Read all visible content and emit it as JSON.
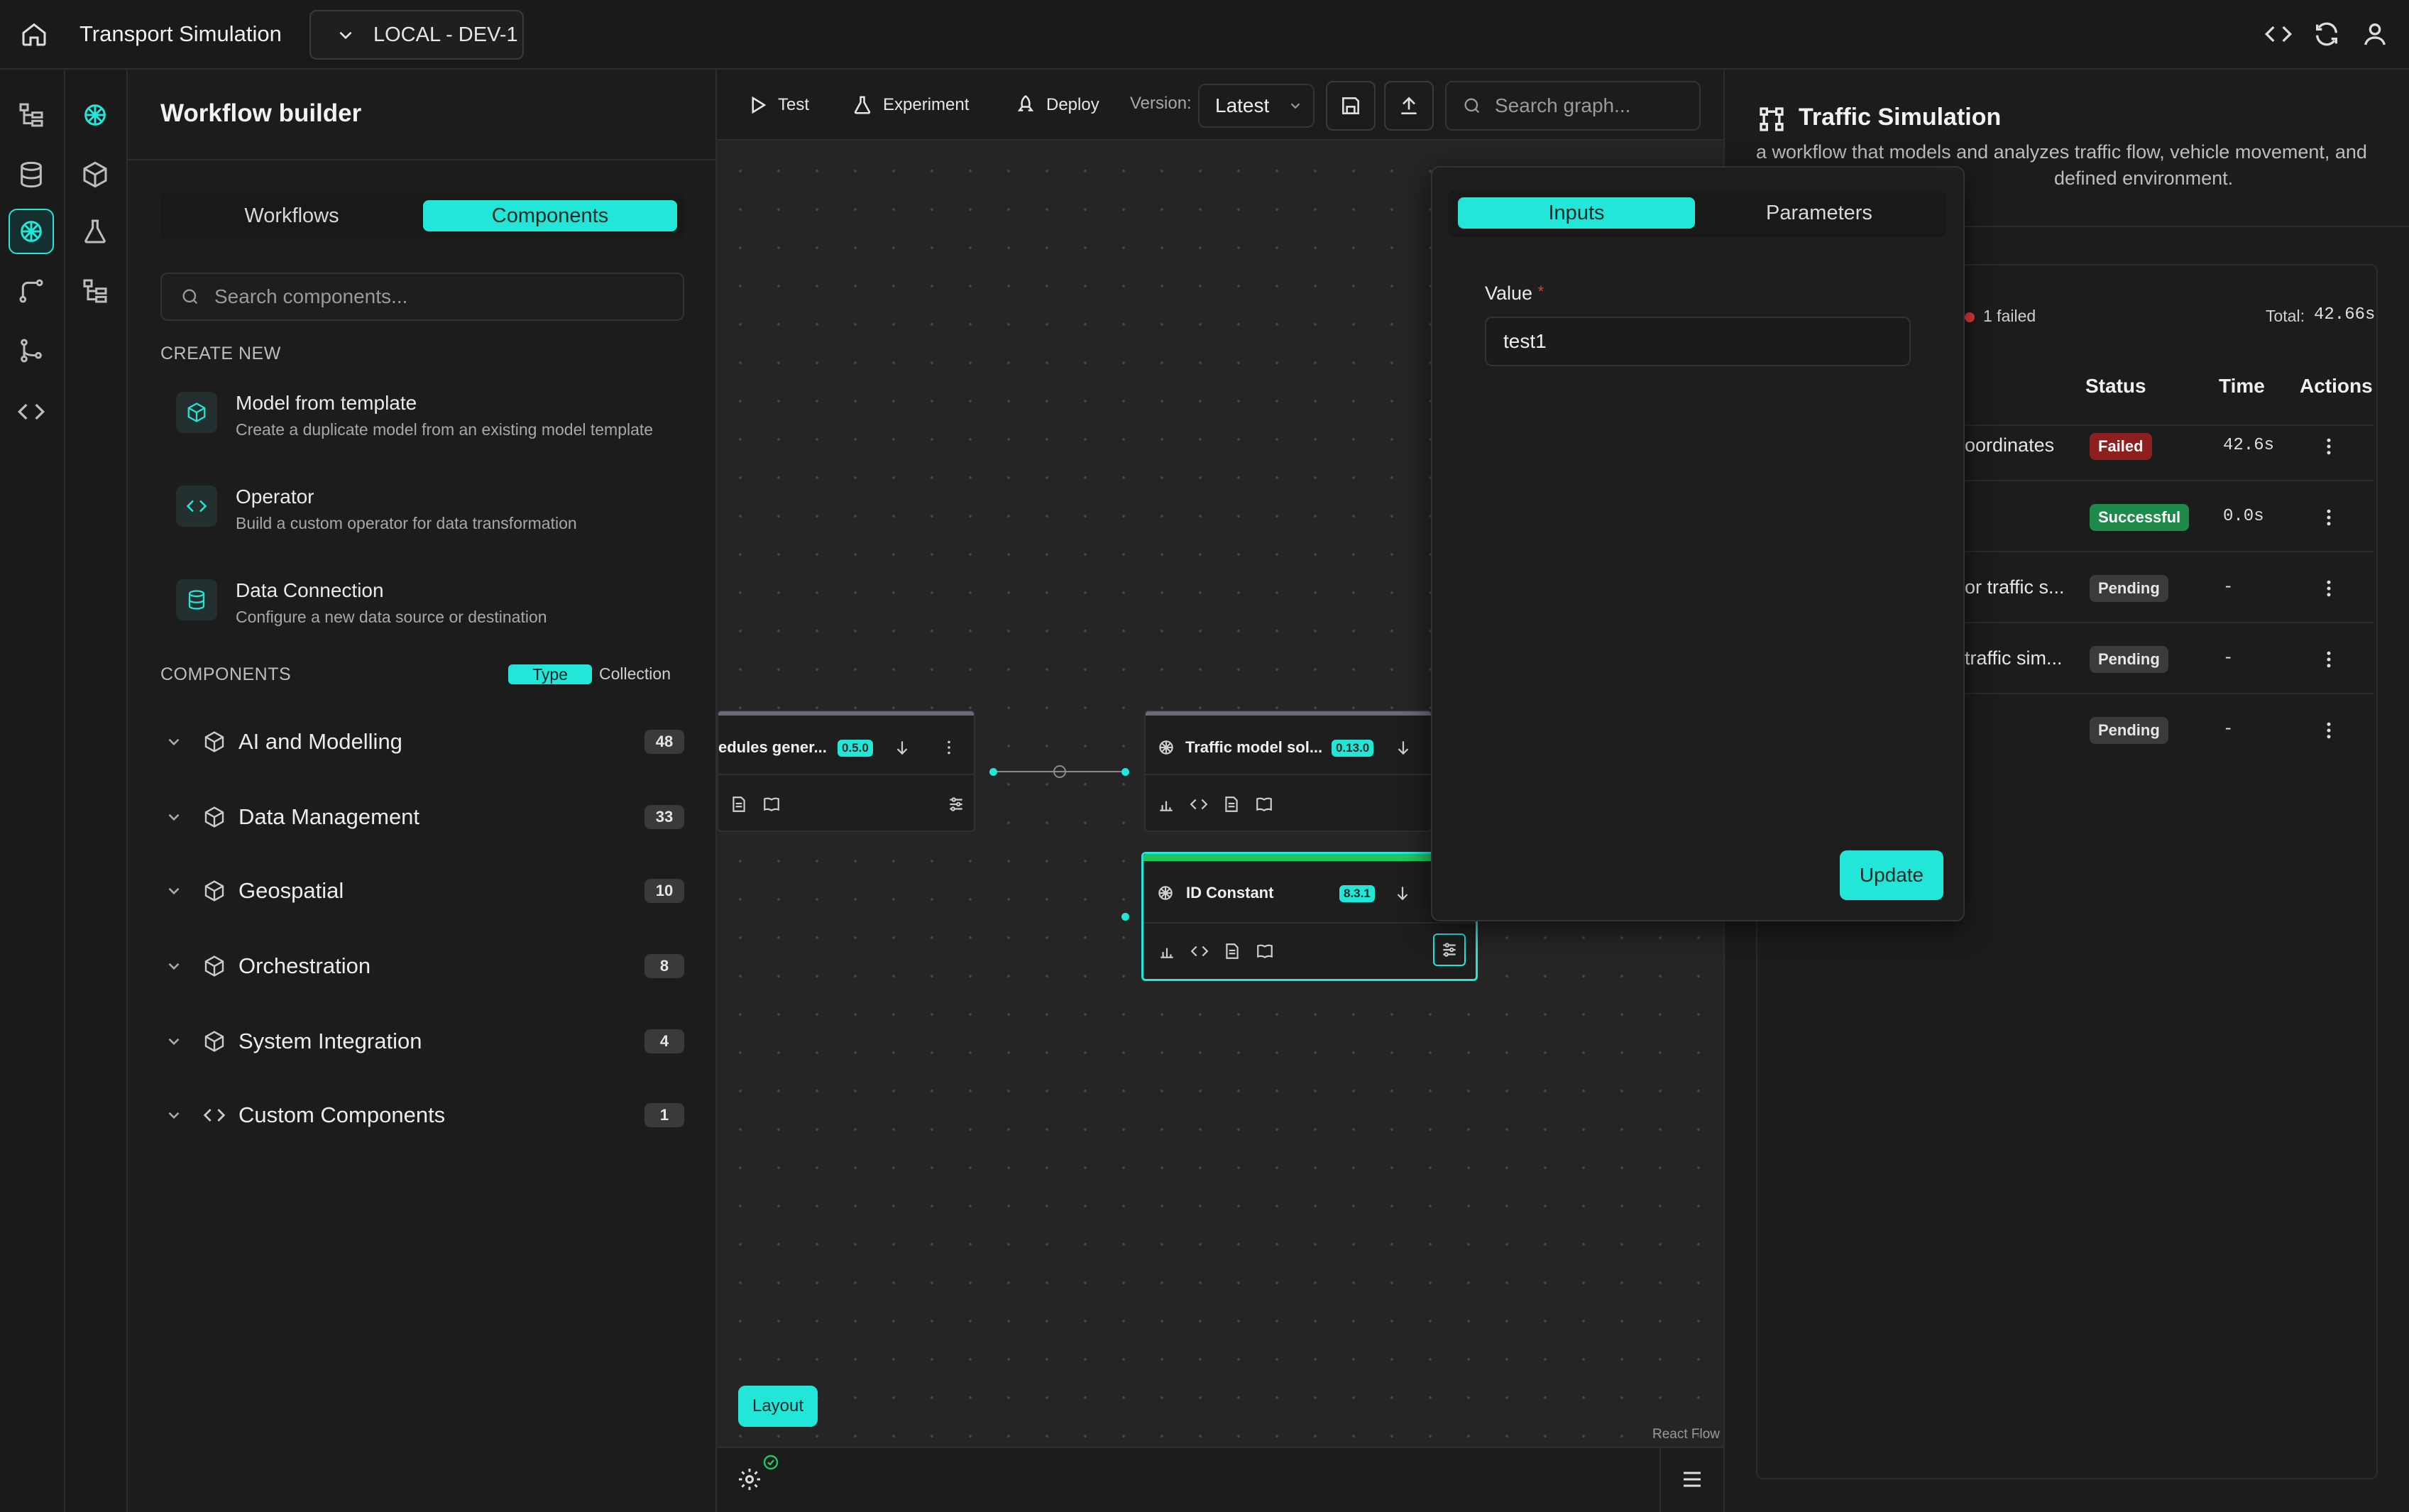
{
  "app": {
    "title": "Transport Simulation",
    "environment": "LOCAL - DEV-1"
  },
  "sidebar": {
    "title": "Workflow builder",
    "tabs": [
      "Workflows",
      "Components"
    ],
    "active_tab": "Components",
    "search_placeholder": "Search components...",
    "create_new_label": "CREATE NEW",
    "create_items": [
      {
        "title": "Model from template",
        "desc": "Create a duplicate model from an existing model template",
        "icon": "cube-icon"
      },
      {
        "title": "Operator",
        "desc": "Build a custom operator for data transformation",
        "icon": "code-icon"
      },
      {
        "title": "Data Connection",
        "desc": "Configure a new data source or destination",
        "icon": "database-icon"
      }
    ],
    "components_label": "COMPONENTS",
    "group_by": [
      "Type",
      "Collection"
    ],
    "categories": [
      {
        "label": "AI and Modelling",
        "count": "48"
      },
      {
        "label": "Data Management",
        "count": "33"
      },
      {
        "label": "Geospatial",
        "count": "10"
      },
      {
        "label": "Orchestration",
        "count": "8"
      },
      {
        "label": "System Integration",
        "count": "4"
      },
      {
        "label": "Custom Components",
        "count": "1"
      }
    ]
  },
  "toolbar": {
    "test": "Test",
    "experiment": "Experiment",
    "deploy": "Deploy",
    "version_label": "Version:",
    "version_value": "Latest",
    "search_placeholder": "Search graph..."
  },
  "nodes": [
    {
      "title": "edules gener...",
      "version": "0.5.0"
    },
    {
      "title": "Traffic model sol...",
      "version": "0.13.0"
    },
    {
      "title": "ID Constant",
      "version": "8.3.1"
    }
  ],
  "canvas": {
    "layout_button": "Layout",
    "attribution": "React Flow"
  },
  "popover": {
    "tabs": [
      "Inputs",
      "Parameters"
    ],
    "active_tab": "Inputs",
    "field_label": "Value",
    "required_mark": "*",
    "field_value": "test1",
    "update_button": "Update"
  },
  "right_panel": {
    "title": "Traffic Simulation",
    "description_line1": "a workflow that models and analyzes traffic flow, vehicle movement, and",
    "description_line2": "defined environment.",
    "failed_summary": "1 failed",
    "total_label": "Total:",
    "total_value": "42.66s",
    "columns": [
      "Status",
      "Time",
      "Actions"
    ],
    "rows": [
      {
        "name": "oordinates",
        "status": "Failed",
        "time": "42.6s"
      },
      {
        "name": "",
        "status": "Successful",
        "time": "0.0s"
      },
      {
        "name": "or traffic s...",
        "status": "Pending",
        "time": "-"
      },
      {
        "name": "traffic sim...",
        "status": "Pending",
        "time": "-"
      },
      {
        "name": "",
        "status": "Pending",
        "time": "-"
      }
    ]
  },
  "colors": {
    "accent": "#22e6d8",
    "failed": "#8e1f1f",
    "successful": "#1e8a4a",
    "pending": "#3b3b3b",
    "background": "#1c1c1c"
  }
}
